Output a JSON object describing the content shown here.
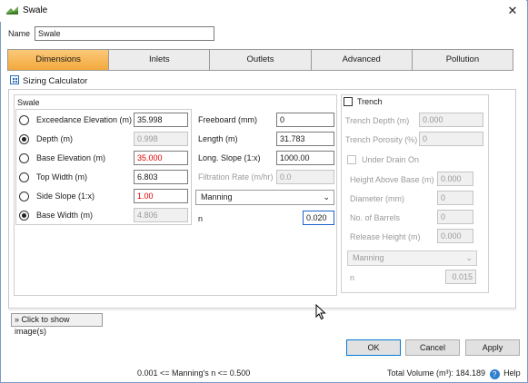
{
  "window": {
    "title": "Swale",
    "close_glyph": "✕"
  },
  "name": {
    "label": "Name",
    "value": "Swale"
  },
  "tabs": [
    {
      "label": "Dimensions",
      "active": true
    },
    {
      "label": "Inlets"
    },
    {
      "label": "Outlets"
    },
    {
      "label": "Advanced"
    },
    {
      "label": "Pollution"
    }
  ],
  "sizing_calculator": {
    "label": "Sizing Calculator",
    "icon": "calculator-icon"
  },
  "swale": {
    "title": "Swale",
    "exceedance_elevation": {
      "label": "Exceedance Elevation (m)",
      "value": "35.998",
      "selected": false
    },
    "depth": {
      "label": "Depth (m)",
      "value": "0.998",
      "selected": true
    },
    "base_elevation": {
      "label": "Base Elevation (m)",
      "value": "35.000",
      "selected": false
    },
    "top_width": {
      "label": "Top Width (m)",
      "value": "6.803",
      "selected": false
    },
    "side_slope": {
      "label": "Side Slope (1:x)",
      "value": "1.00",
      "selected": false
    },
    "base_width": {
      "label": "Base Width (m)",
      "value": "4.806",
      "selected": true
    },
    "freeboard": {
      "label": "Freeboard (mm)",
      "value": "0"
    },
    "length": {
      "label": "Length (m)",
      "value": "31.783"
    },
    "long_slope": {
      "label": "Long. Slope (1:x)",
      "value": "1000.00"
    },
    "filtration_rate": {
      "label": "Filtration Rate (m/hr)",
      "value": "0.0"
    },
    "roughness_method": "Manning",
    "n": {
      "label": "n",
      "value": "0.020"
    }
  },
  "trench": {
    "label": "Trench",
    "checked": false,
    "trench_depth": {
      "label": "Trench Depth (m)",
      "value": "0.000"
    },
    "trench_porosity": {
      "label": "Trench Porosity (%)",
      "value": "0"
    },
    "under_drain": {
      "label": "Under Drain On",
      "checked": false
    },
    "height_above_base": {
      "label": "Height Above Base (m)",
      "value": "0.000"
    },
    "diameter": {
      "label": "Diameter (mm)",
      "value": "0"
    },
    "no_of_barrels": {
      "label": "No. of Barrels",
      "value": "0"
    },
    "release_height": {
      "label": "Release Height (m)",
      "value": "0.000"
    },
    "roughness_method": "Manning",
    "n": {
      "label": "n",
      "value": "0.015"
    }
  },
  "show_images": {
    "label": "Click to show image(s)",
    "icon": "double-chevron-down-icon"
  },
  "buttons": {
    "ok": "OK",
    "cancel": "Cancel",
    "apply": "Apply"
  },
  "status": {
    "range_text": "0.001 <= Manning's n <= 0.500",
    "total_volume": "Total Volume (m³): 184.189",
    "help": "Help"
  },
  "colors": {
    "tab_active": "#f3a93d",
    "warning_text": "#e00000",
    "focus_border": "#1d62c8"
  }
}
